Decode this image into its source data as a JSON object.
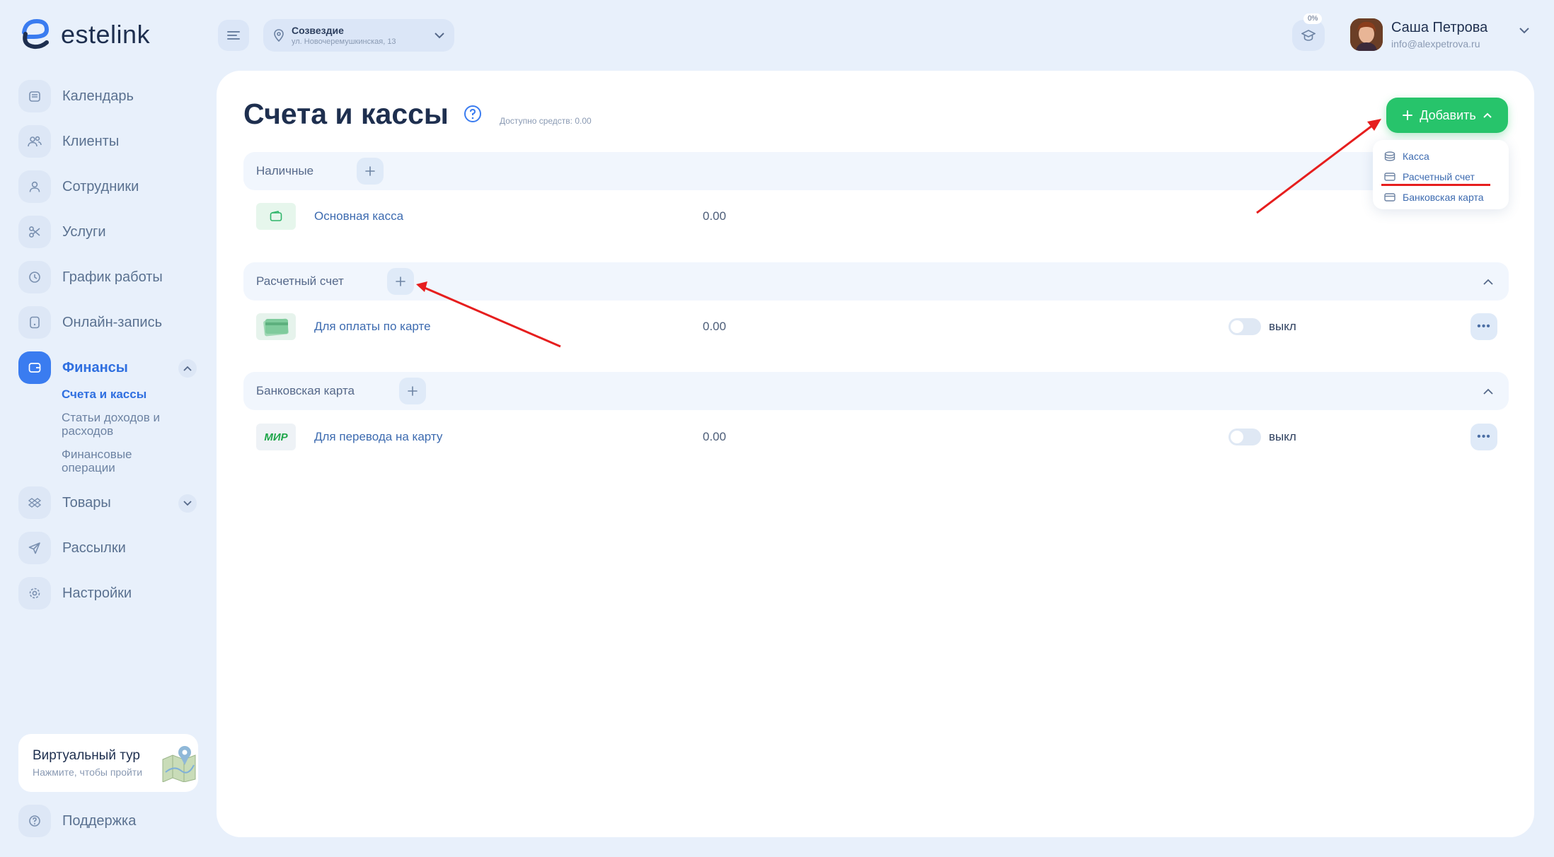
{
  "header": {
    "brand": "estelink",
    "location_name": "Созвездие",
    "location_address": "ул. Новочеремушкинская, 13",
    "progress_badge": "0%",
    "user_name": "Саша Петрова",
    "user_email": "info@alexpetrova.ru"
  },
  "sidebar": {
    "items": [
      {
        "label": "Календарь",
        "icon": "calendar-icon"
      },
      {
        "label": "Клиенты",
        "icon": "clients-icon"
      },
      {
        "label": "Сотрудники",
        "icon": "user-icon"
      },
      {
        "label": "Услуги",
        "icon": "scissors-icon"
      },
      {
        "label": "График работы",
        "icon": "clock-icon"
      },
      {
        "label": "Онлайн-запись",
        "icon": "phone-icon"
      },
      {
        "label": "Финансы",
        "icon": "wallet-icon"
      },
      {
        "label": "Товары",
        "icon": "box-icon"
      },
      {
        "label": "Рассылки",
        "icon": "send-icon"
      },
      {
        "label": "Настройки",
        "icon": "gear-icon"
      }
    ],
    "finance_sub": [
      "Счета и кассы",
      "Статьи доходов и расходов",
      "Финансовые операции"
    ],
    "tour_title": "Виртуальный тур",
    "tour_subtitle": "Нажмите, чтобы пройти",
    "support": "Поддержка"
  },
  "main": {
    "title": "Счета и кассы",
    "available": "Доступно средств: 0.00",
    "add_button": "Добавить",
    "dropdown": [
      "Касса",
      "Расчетный счет",
      "Банковская карта"
    ],
    "sections": [
      {
        "title": "Наличные",
        "rows": [
          {
            "name": "Основная касса",
            "value": "0.00"
          }
        ]
      },
      {
        "title": "Расчетный счет",
        "rows": [
          {
            "name": "Для оплаты по карте",
            "value": "0.00",
            "toggle": "выкл"
          }
        ]
      },
      {
        "title": "Банковская карта",
        "rows": [
          {
            "name": "Для перевода на карту",
            "value": "0.00",
            "toggle": "выкл",
            "card_brand": "МИР"
          }
        ]
      }
    ]
  },
  "colors": {
    "accent": "#3a7cf0",
    "add_green": "#27c46b",
    "annotation_red": "#e61e1e"
  }
}
